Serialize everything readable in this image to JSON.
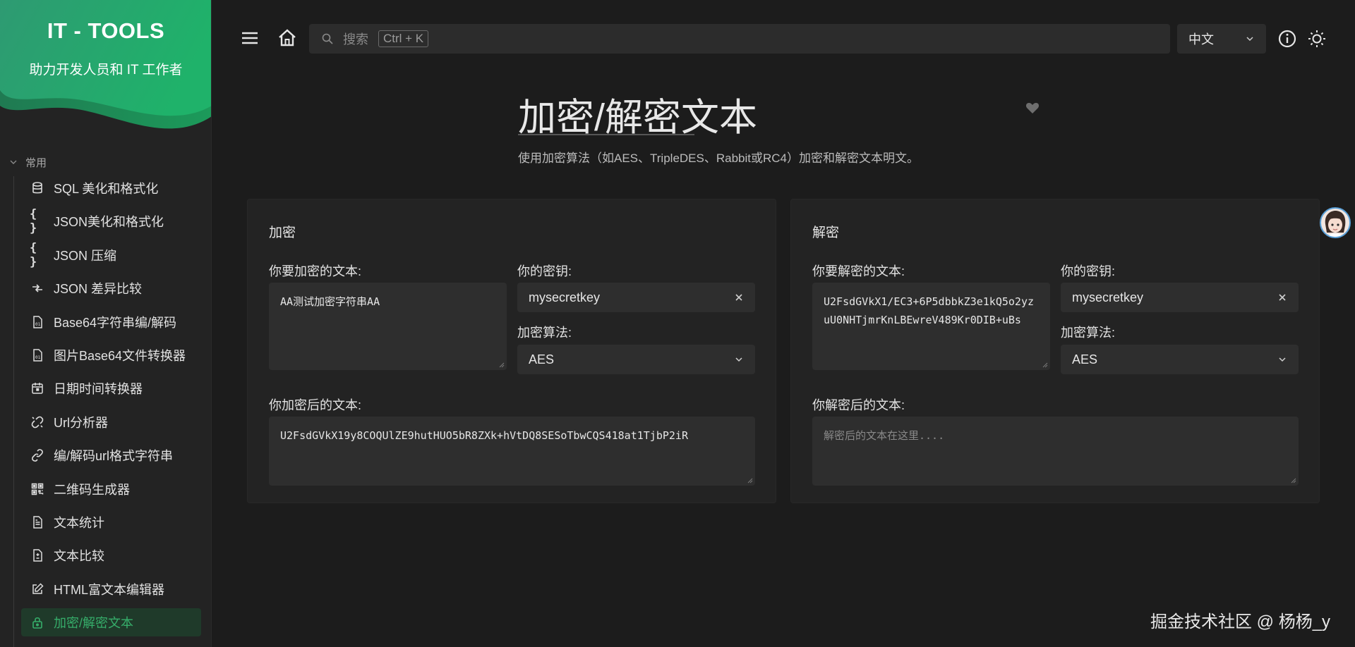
{
  "app": {
    "title": "IT - TOOLS",
    "subtitle": "助力开发人员和 IT 工作者"
  },
  "colors": {
    "accent": "#36ad6a",
    "hero_green": "#1ea36a",
    "background": "#1c1c1c",
    "sidebar": "#232323"
  },
  "sidebar": {
    "section_label": "常用",
    "items": [
      {
        "label": "SQL 美化和格式化",
        "icon": "database-icon"
      },
      {
        "label": "JSON美化和格式化",
        "icon": "braces-icon"
      },
      {
        "label": "JSON 压缩",
        "icon": "braces-icon"
      },
      {
        "label": "JSON 差异比较",
        "icon": "compare-arrows-icon"
      },
      {
        "label": "Base64字符串编/解码",
        "icon": "binary-file-icon"
      },
      {
        "label": "图片Base64文件转换器",
        "icon": "binary-file-icon"
      },
      {
        "label": "日期时间转换器",
        "icon": "calendar-icon"
      },
      {
        "label": "Url分析器",
        "icon": "unlink-icon"
      },
      {
        "label": "编/解码url格式字符串",
        "icon": "link-icon"
      },
      {
        "label": "二维码生成器",
        "icon": "qrcode-icon"
      },
      {
        "label": "文本统计",
        "icon": "document-icon"
      },
      {
        "label": "文本比较",
        "icon": "file-diff-icon"
      },
      {
        "label": "HTML富文本编辑器",
        "icon": "edit-icon"
      },
      {
        "label": "加密/解密文本",
        "icon": "lock-icon",
        "active": true
      }
    ]
  },
  "topbar": {
    "search_placeholder": "搜索",
    "search_shortcut": "Ctrl + K",
    "language": "中文"
  },
  "page": {
    "title": "加密/解密文本",
    "description": "使用加密算法（如AES、TripleDES、Rabbit或RC4）加密和解密文本明文。"
  },
  "encrypt": {
    "card_title": "加密",
    "text_label": "你要加密的文本:",
    "text_value": "AA测试加密字符串AA",
    "key_label": "你的密钥:",
    "key_value": "mysecretkey",
    "algo_label": "加密算法:",
    "algo_value": "AES",
    "output_label": "你加密后的文本:",
    "output_value": "U2FsdGVkX19y8COQUlZE9hutHUO5bR8ZXk+hVtDQ8SESoTbwCQS418at1TjbP2iR"
  },
  "decrypt": {
    "card_title": "解密",
    "text_label": "你要解密的文本:",
    "text_value": "U2FsdGVkX1/EC3+6P5dbbkZ3e1kQ5o2yzuU0NHTjmrKnLBEwreV489Kr0DIB+uBs",
    "key_label": "你的密钥:",
    "key_value": "mysecretkey",
    "algo_label": "加密算法:",
    "algo_value": "AES",
    "output_label": "你解密后的文本:",
    "output_placeholder": "解密后的文本在这里...."
  },
  "watermark": "掘金技术社区 @ 杨杨_y"
}
